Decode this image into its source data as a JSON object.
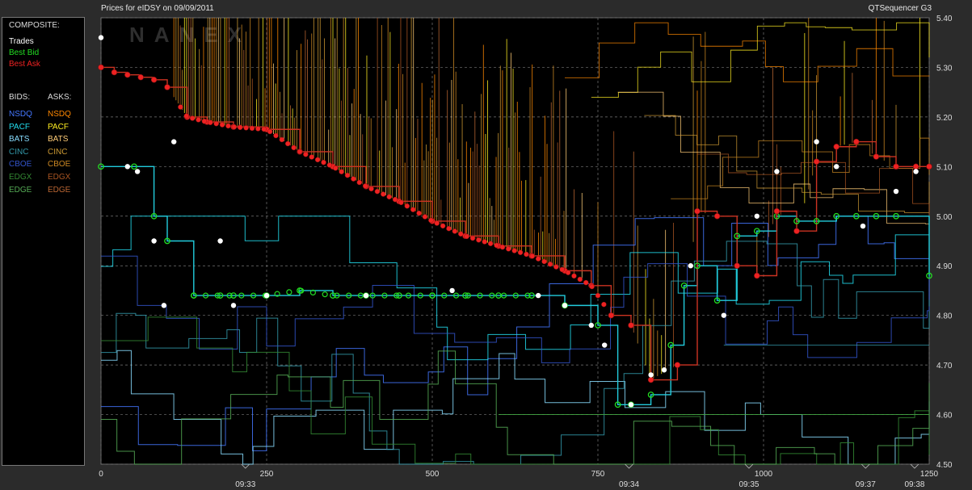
{
  "header": {
    "title": "Prices for  eIDSY  on  09/09/2011",
    "product": "QTSequencer G3",
    "watermark": "NANEX"
  },
  "legend": {
    "composite_label": "COMPOSITE:",
    "composite": [
      {
        "label": "Trades",
        "color": "#ffffff"
      },
      {
        "label": "Best Bid",
        "color": "#22dd22"
      },
      {
        "label": "Best Ask",
        "color": "#ee2222"
      }
    ],
    "bids_label": "BIDS:",
    "asks_label": "ASKS:",
    "exchanges": [
      {
        "bid": "NSDQ",
        "bid_color": "#4477ff",
        "ask": "NSDQ",
        "ask_color": "#ff8800"
      },
      {
        "bid": "PACF",
        "bid_color": "#22ddee",
        "ask": "PACF",
        "ask_color": "#ffee22"
      },
      {
        "bid": "BATS",
        "bid_color": "#88ddff",
        "ask": "BATS",
        "ask_color": "#ffcc77"
      },
      {
        "bid": "CINC",
        "bid_color": "#3399aa",
        "ask": "CINC",
        "ask_color": "#cc9933"
      },
      {
        "bid": "CBOE",
        "bid_color": "#3355cc",
        "ask": "CBOE",
        "ask_color": "#cc8822"
      },
      {
        "bid": "EDGX",
        "bid_color": "#338833",
        "ask": "EDGX",
        "ask_color": "#aa5522"
      },
      {
        "bid": "EDGE",
        "bid_color": "#55aa55",
        "ask": "EDGE",
        "ask_color": "#bb6633"
      }
    ]
  },
  "chart_data": {
    "type": "line",
    "title": "Prices for  eIDSY  on  09/09/2011",
    "xlabel": "",
    "ylabel": "",
    "xlim": [
      0,
      1250
    ],
    "ylim": [
      4.5,
      5.4
    ],
    "x_ticks": [
      "0",
      "250",
      "500",
      "750",
      "1000",
      "1250"
    ],
    "x_tick_values": [
      0,
      250,
      500,
      750,
      1000,
      1250
    ],
    "time_ticks": [
      {
        "label": "09:33",
        "x": 218
      },
      {
        "label": "09:34",
        "x": 797
      },
      {
        "label": "09:35",
        "x": 978
      },
      {
        "label": "09:37",
        "x": 1154
      },
      {
        "label": "09:38",
        "x": 1228
      }
    ],
    "y_ticks": [
      "5.40",
      "5.30",
      "5.20",
      "5.10",
      "5.00",
      "4.90",
      "4.80",
      "4.70",
      "4.60",
      "4.50"
    ],
    "y_tick_values": [
      5.4,
      5.3,
      5.2,
      5.1,
      5.0,
      4.9,
      4.8,
      4.7,
      4.6,
      4.5
    ],
    "grid": true,
    "colors": {
      "trades": "#ffffff",
      "best_bid": "#22dd22",
      "best_ask": "#ee2222"
    },
    "series": [
      {
        "name": "Best Ask",
        "x": [
          0,
          20,
          40,
          60,
          80,
          100,
          130,
          160,
          200,
          250,
          300,
          350,
          400,
          450,
          500,
          550,
          600,
          650,
          700,
          740,
          770,
          800,
          830,
          870,
          900,
          930,
          960,
          990,
          1020,
          1050,
          1080,
          1110,
          1140,
          1170,
          1200,
          1230,
          1250
        ],
        "y": [
          5.3,
          5.29,
          5.285,
          5.28,
          5.275,
          5.26,
          5.2,
          5.19,
          5.18,
          5.175,
          5.13,
          5.1,
          5.06,
          5.03,
          4.99,
          4.96,
          4.94,
          4.92,
          4.89,
          4.86,
          4.8,
          4.78,
          4.67,
          4.7,
          5.01,
          5.0,
          4.9,
          4.88,
          5.01,
          4.97,
          5.11,
          5.14,
          5.15,
          5.12,
          5.1,
          5.1,
          5.1
        ]
      },
      {
        "name": "Best Bid",
        "x": [
          0,
          50,
          80,
          100,
          140,
          180,
          200,
          250,
          300,
          350,
          400,
          450,
          500,
          550,
          600,
          650,
          700,
          750,
          780,
          800,
          830,
          860,
          880,
          900,
          930,
          960,
          990,
          1020,
          1050,
          1080,
          1110,
          1140,
          1170,
          1200,
          1250
        ],
        "y": [
          5.1,
          5.1,
          5.0,
          4.95,
          4.84,
          4.84,
          4.84,
          4.84,
          4.85,
          4.84,
          4.84,
          4.84,
          4.84,
          4.84,
          4.84,
          4.84,
          4.82,
          4.78,
          4.62,
          4.62,
          4.64,
          4.74,
          4.86,
          4.9,
          4.83,
          4.96,
          4.97,
          5.0,
          4.99,
          4.99,
          5.0,
          5.0,
          5.0,
          5.0,
          4.88
        ]
      },
      {
        "name": "Trades",
        "x": [
          0,
          40,
          55,
          80,
          95,
          110,
          180,
          200,
          250,
          400,
          530,
          660,
          700,
          740,
          760,
          800,
          830,
          850,
          890,
          940,
          990,
          1020,
          1080,
          1110,
          1150,
          1200,
          1230
        ],
        "y": [
          5.36,
          5.1,
          5.09,
          4.95,
          4.82,
          5.15,
          4.95,
          4.82,
          4.84,
          4.84,
          4.85,
          4.84,
          4.82,
          4.78,
          4.74,
          4.62,
          4.68,
          4.69,
          4.9,
          4.8,
          5.0,
          5.09,
          5.15,
          5.1,
          4.98,
          5.05,
          5.09
        ]
      }
    ]
  }
}
